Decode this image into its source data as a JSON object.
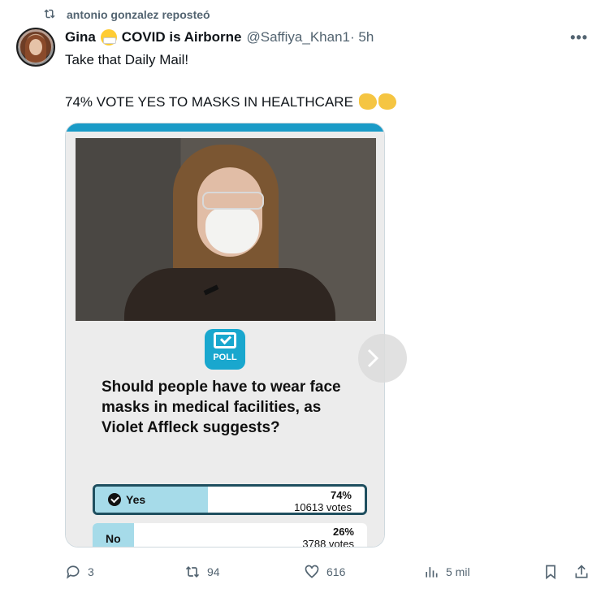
{
  "repost": {
    "text": "antonio gonzalez reposteó"
  },
  "tweet": {
    "display_name_part1": "Gina",
    "display_name_part2": "COVID is Airborne",
    "handle": "@Saffiya_Khan1",
    "time": " · 5h",
    "more_label": "•••",
    "line1": "Take that Daily Mail!",
    "line2": "74% VOTE YES TO MASKS IN HEALTHCARE"
  },
  "poll": {
    "icon_label": "POLL",
    "question": "Should people have to wear face masks in medical facilities, as Violet Affleck suggests?",
    "options": [
      {
        "label": "Yes",
        "percent": "74%",
        "votes": "10613 votes",
        "fill": 0.42,
        "selected": true
      },
      {
        "label": "No",
        "percent": "26%",
        "votes": "3788 votes",
        "fill": 0.15,
        "selected": false
      }
    ]
  },
  "actions": {
    "replies": "3",
    "reposts": "94",
    "likes": "616",
    "views": "5 mil"
  },
  "colors": {
    "accent": "#1a9bc7",
    "poll_fill": "#a6dbe9",
    "muted_text": "#536471"
  },
  "icons": {
    "repost": "repost-icon",
    "reply": "reply-icon",
    "like": "heart-icon",
    "views": "views-icon",
    "bookmark": "bookmark-icon",
    "share": "share-icon",
    "more": "more-icon",
    "next": "chevron-right-icon"
  }
}
